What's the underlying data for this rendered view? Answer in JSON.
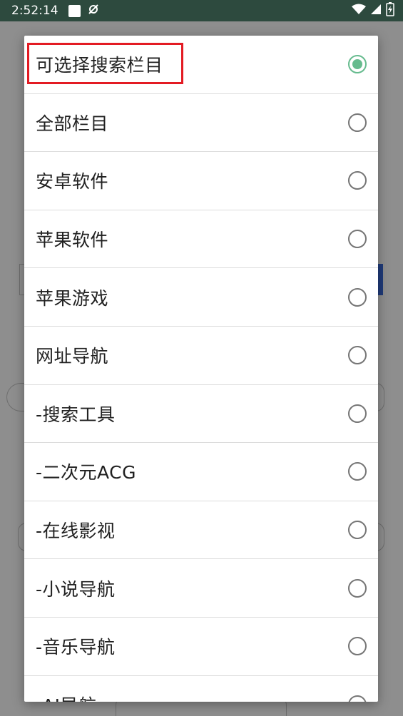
{
  "status_bar": {
    "time": "2:52:14"
  },
  "dialog": {
    "options": [
      {
        "label": "可选择搜索栏目",
        "checked": true
      },
      {
        "label": "全部栏目",
        "checked": false
      },
      {
        "label": "安卓软件",
        "checked": false
      },
      {
        "label": "苹果软件",
        "checked": false
      },
      {
        "label": "苹果游戏",
        "checked": false
      },
      {
        "label": "网址导航",
        "checked": false
      },
      {
        "label": "-搜索工具",
        "checked": false
      },
      {
        "label": "-二次元ACG",
        "checked": false
      },
      {
        "label": "-在线影视",
        "checked": false
      },
      {
        "label": "-小说导航",
        "checked": false
      },
      {
        "label": "-音乐导航",
        "checked": false
      },
      {
        "label": "-AI导航",
        "checked": false
      }
    ]
  },
  "colors": {
    "status_bar_bg": "#2d4a3e",
    "radio_checked": "#66bb8e",
    "highlight_border": "#e31b23"
  }
}
